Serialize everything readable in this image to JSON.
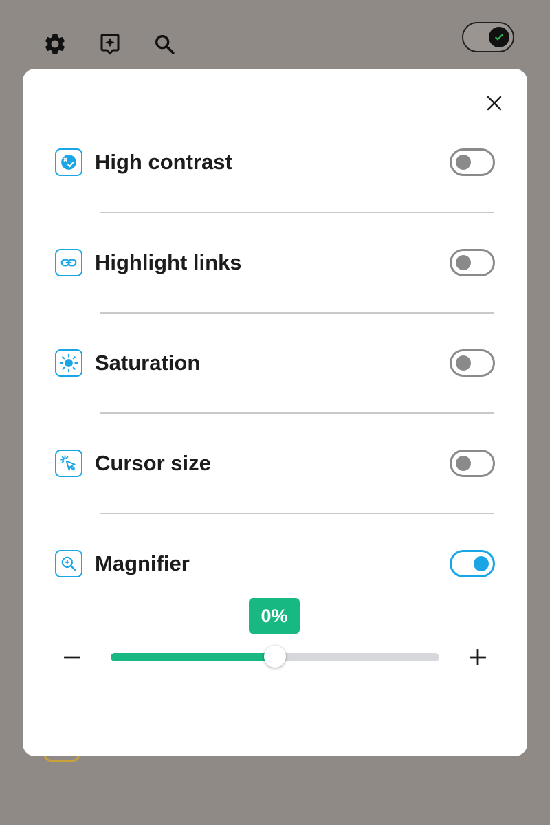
{
  "top_bar": {
    "icons": [
      "gear-icon",
      "spark-icon",
      "search-icon"
    ],
    "master_toggle": {
      "state": "on",
      "knob_icon": "check-icon"
    }
  },
  "modal": {
    "close_icon": "close-icon",
    "options": [
      {
        "label": "High contrast",
        "icon": "contrast-icon",
        "enabled": false
      },
      {
        "label": "Highlight links",
        "icon": "link-icon",
        "enabled": false
      },
      {
        "label": "Saturation",
        "icon": "sun-icon",
        "enabled": false
      },
      {
        "label": "Cursor size",
        "icon": "cursor-icon",
        "enabled": false
      },
      {
        "label": "Magnifier",
        "icon": "magnifier-icon",
        "enabled": true
      }
    ],
    "magnifier_slider": {
      "value_label": "0%",
      "position_fraction": 0.5,
      "decrease_icon": "minus-icon",
      "increase_icon": "plus-icon"
    }
  },
  "colors": {
    "accent": "#1aa6e6",
    "slider_fill": "#17b882",
    "toggle_off": "#8a8a8a",
    "overlay_background": "#8f8a85"
  }
}
